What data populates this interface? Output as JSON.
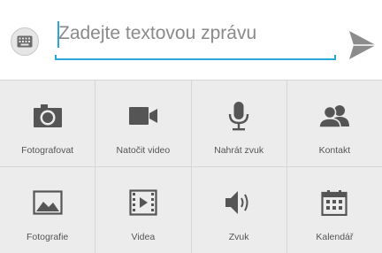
{
  "composer": {
    "placeholder": "Zadejte textovou zprávu"
  },
  "attachments": [
    {
      "label": "Fotografovat",
      "icon": "camera-icon"
    },
    {
      "label": "Natočit video",
      "icon": "video-camera-icon"
    },
    {
      "label": "Nahrát zvuk",
      "icon": "microphone-icon"
    },
    {
      "label": "Kontakt",
      "icon": "contact-icon"
    },
    {
      "label": "Fotografie",
      "icon": "picture-icon"
    },
    {
      "label": "Videa",
      "icon": "video-file-icon"
    },
    {
      "label": "Zvuk",
      "icon": "speaker-icon"
    },
    {
      "label": "Kalendář",
      "icon": "calendar-icon"
    }
  ],
  "colors": {
    "accent": "#2aa7d8",
    "icon": "#555555",
    "tile_bg": "#ececec"
  }
}
